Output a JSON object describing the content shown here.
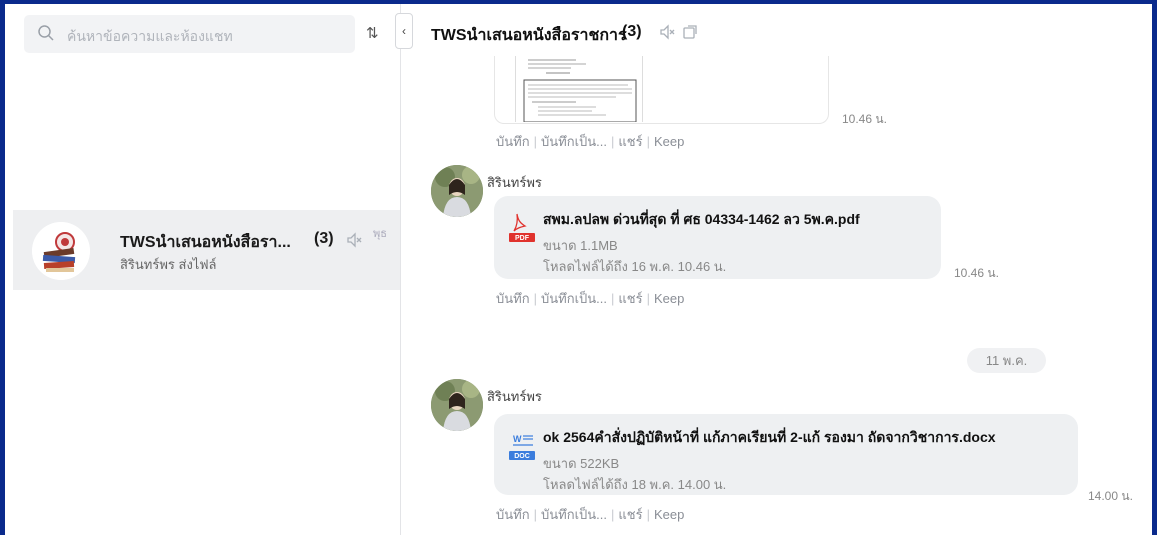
{
  "search": {
    "placeholder": "ค้นหาข้อความและห้องแชท"
  },
  "sort_label": "⇅",
  "collapse_label": "‹",
  "chat_list": [
    {
      "name": "TWSนำเสนอหนังสือรา...",
      "count": "(3)",
      "day": "พุธ",
      "preview": "สิรินทร์พร ส่งไฟล์"
    }
  ],
  "header": {
    "title": "TWSนำเสนอหนังสือราชการ",
    "count": "(3)"
  },
  "actions": {
    "save": "บันทึก",
    "save_as": "บันทึกเป็น...",
    "share": "แชร์",
    "keep": "Keep"
  },
  "messages": [
    {
      "type": "image",
      "time": "10.46 น."
    },
    {
      "type": "file",
      "sender": "สิรินทร์พร",
      "file_type": "PDF",
      "file_name": "สพม.ลปลพ ด่วนที่สุด ที่ ศธ 04334-1462 ลว 5พ.ค.pdf",
      "size": "ขนาด 1.1MB",
      "expires": "โหลดไฟล์ได้ถึง 16 พ.ค. 10.46 น.",
      "time": "10.46 น."
    },
    {
      "type": "date",
      "label": "11 พ.ค."
    },
    {
      "type": "file",
      "sender": "สิรินทร์พร",
      "file_type": "DOC",
      "file_name": "ok 2564คำสั่งปฏิบัติหน้าที่ แก้ภาคเรียนที่ 2-แก้ รองมา ถัดจากวิชาการ.docx",
      "size": "ขนาด 522KB",
      "expires": "โหลดไฟล์ได้ถึง 18 พ.ค. 14.00 น.",
      "time": "14.00 น."
    }
  ],
  "colors": {
    "frame": "#0a2a8c",
    "pdf": "#e0322d",
    "doc": "#3b7ddd",
    "bubble": "#eef0f2"
  }
}
